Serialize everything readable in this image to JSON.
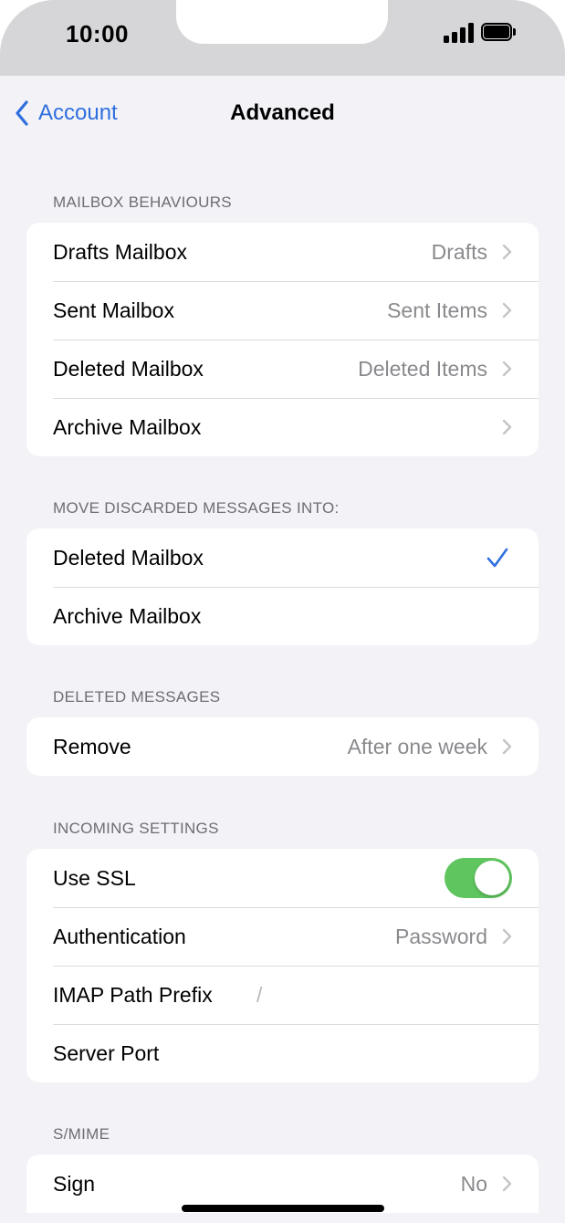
{
  "status": {
    "time": "10:00"
  },
  "nav": {
    "back_label": "Account",
    "title": "Advanced"
  },
  "sections": {
    "mailbox_behaviours": {
      "header": "MAILBOX BEHAVIOURS",
      "rows": [
        {
          "label": "Drafts Mailbox",
          "value": "Drafts"
        },
        {
          "label": "Sent Mailbox",
          "value": "Sent Items"
        },
        {
          "label": "Deleted Mailbox",
          "value": "Deleted Items"
        },
        {
          "label": "Archive Mailbox",
          "value": ""
        }
      ]
    },
    "move_discarded": {
      "header": "MOVE DISCARDED MESSAGES INTO:",
      "rows": [
        {
          "label": "Deleted Mailbox",
          "selected": true
        },
        {
          "label": "Archive Mailbox",
          "selected": false
        }
      ]
    },
    "deleted_messages": {
      "header": "DELETED MESSAGES",
      "rows": [
        {
          "label": "Remove",
          "value": "After one week"
        }
      ]
    },
    "incoming_settings": {
      "header": "INCOMING SETTINGS",
      "use_ssl": {
        "label": "Use SSL",
        "on": true
      },
      "authentication": {
        "label": "Authentication",
        "value": "Password"
      },
      "imap_path_prefix": {
        "label": "IMAP Path Prefix",
        "value": "/"
      },
      "server_port": {
        "label": "Server Port",
        "value": ""
      }
    },
    "smime": {
      "header": "S/MIME",
      "rows": [
        {
          "label": "Sign",
          "value": "No"
        }
      ]
    }
  },
  "colors": {
    "accent": "#2f6fde",
    "toggle_on": "#5fc65f",
    "background": "#f2f2f7",
    "secondary_text": "#8a8a8e"
  }
}
